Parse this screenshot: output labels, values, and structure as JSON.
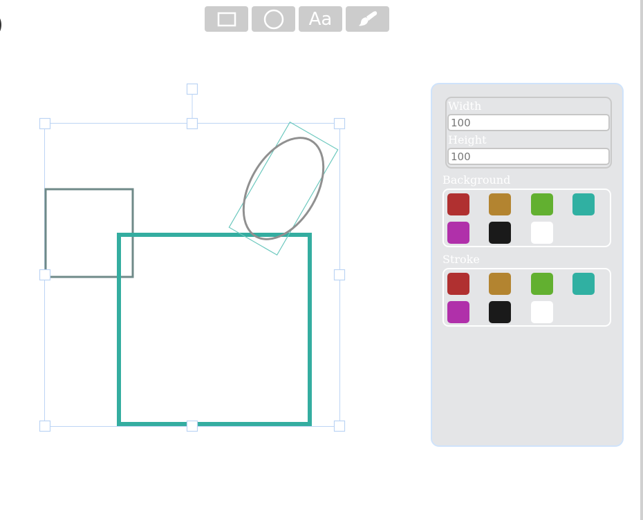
{
  "toolbar": {
    "buttons": [
      {
        "icon": "rectangle-icon"
      },
      {
        "icon": "circle-icon"
      },
      {
        "label": "Aa",
        "icon": "text-icon"
      },
      {
        "icon": "paint-brush-icon"
      }
    ]
  },
  "panel": {
    "width_label": "Width",
    "width_value": "100",
    "height_label": "Height",
    "height_value": "100",
    "background_label": "Background",
    "stroke_label": "Stroke",
    "swatches": [
      "#b03030",
      "#b38430",
      "#62b030",
      "#30b0a2",
      "#b030aa",
      "#1a1a1a",
      "#ffffff"
    ]
  },
  "colors": {
    "toolbar_button": "#cccccc",
    "selection": "#bcd4f4",
    "teal_stroke": "#34ada0",
    "gray_stroke": "#888888",
    "panel_bg": "#e4e5e7"
  }
}
